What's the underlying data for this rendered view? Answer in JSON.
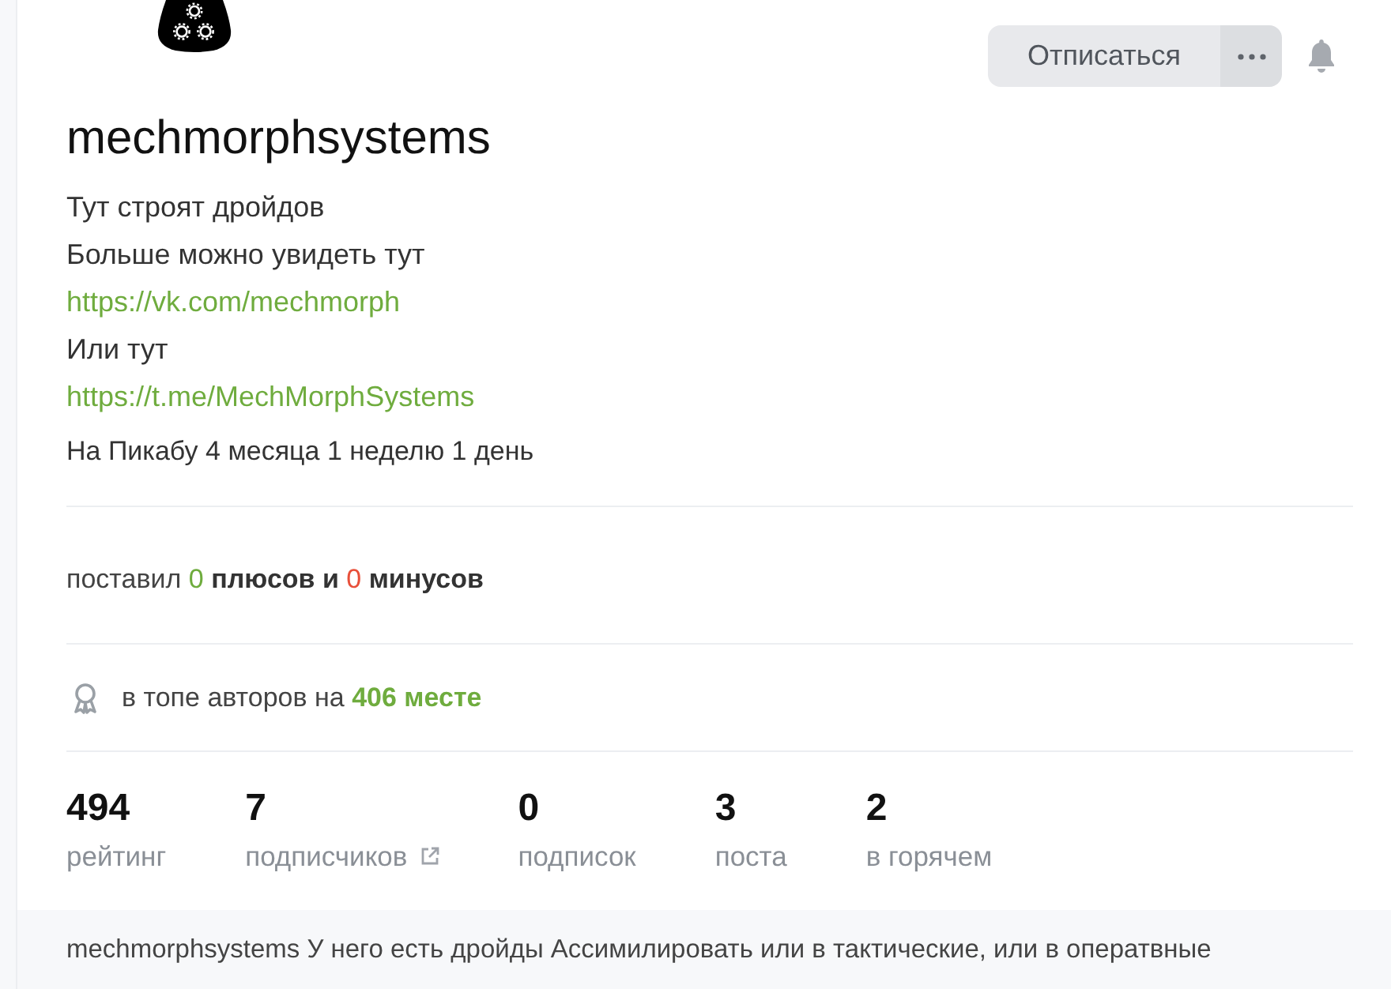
{
  "actions": {
    "unsubscribe_label": "Отписаться"
  },
  "username": "mechmorphsystems",
  "bio": [
    {
      "kind": "text",
      "text": "Тут строят дройдов"
    },
    {
      "kind": "text",
      "text": "Больше можно увидеть тут"
    },
    {
      "kind": "link",
      "text": "https://vk.com/mechmorph"
    },
    {
      "kind": "text",
      "text": "Или тут"
    },
    {
      "kind": "link",
      "text": "https://t.me/MechMorphSystems"
    }
  ],
  "member_since": "На Пикабу 4 месяца 1 неделю 1 день",
  "votes": {
    "prefix": "поставил",
    "plus_count": "0",
    "plus_label": "плюсов и",
    "minus_count": "0",
    "minus_label": "минусов"
  },
  "ranking": {
    "text": "в топе авторов на",
    "place": "406 месте"
  },
  "stats": [
    {
      "value": "494",
      "label": "рейтинг",
      "link_icon": false
    },
    {
      "value": "7",
      "label": "подписчиков",
      "link_icon": true
    },
    {
      "value": "0",
      "label": "подписок",
      "link_icon": false
    },
    {
      "value": "3",
      "label": "поста",
      "link_icon": false
    },
    {
      "value": "2",
      "label": "в горячем",
      "link_icon": false
    }
  ],
  "note": {
    "text": "mechmorphsystems У него есть дройды Ассимилировать или в тактические, или в оператвные"
  }
}
